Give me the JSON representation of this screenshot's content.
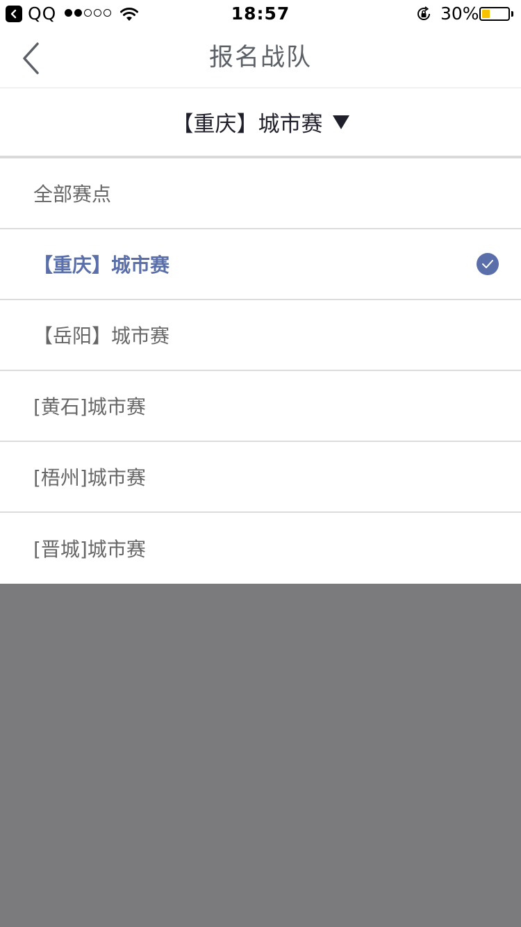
{
  "status_bar": {
    "app_name": "QQ",
    "time": "18:57",
    "battery_percent": "30%",
    "battery_level": 0.3,
    "signal_bars_filled": 2,
    "signal_bars_total": 5,
    "battery_fill_color": "#f7c300"
  },
  "nav": {
    "back_icon": "chevron-left-icon",
    "title": "报名战队"
  },
  "selector": {
    "selected_label": "【重庆】城市赛",
    "caret_icon": "caret-down-icon"
  },
  "options": [
    {
      "label": "全部赛点",
      "selected": false
    },
    {
      "label": "【重庆】城市赛",
      "selected": true
    },
    {
      "label": "【岳阳】城市赛",
      "selected": false
    },
    {
      "label": "[黄石]城市赛",
      "selected": false
    },
    {
      "label": "[梧州]城市赛",
      "selected": false
    },
    {
      "label": "[晋城]城市赛",
      "selected": false
    }
  ],
  "colors": {
    "accent": "#5a6fa9",
    "overlay": "#7b7b7d",
    "title_text": "#5b5f66",
    "option_text": "#666666"
  }
}
